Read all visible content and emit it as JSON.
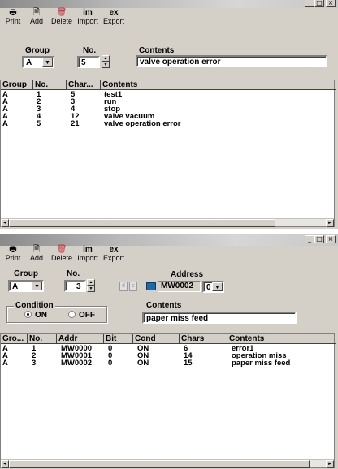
{
  "toolbar": {
    "print_label": "Print",
    "add_label": "Add",
    "delete_label": "Delete",
    "import_icon_text": "im",
    "import_label": "Import",
    "export_icon_text": "ex",
    "export_label": "Export"
  },
  "window_controls": {
    "minimize": "_",
    "maximize": "□",
    "close": "×"
  },
  "panel1": {
    "group_label": "Group",
    "group_value": "A",
    "no_label": "No.",
    "no_value": "5",
    "contents_label": "Contents",
    "contents_value": "valve operation error",
    "columns": [
      "Group",
      "No.",
      "Char...",
      "Contents"
    ],
    "rows": [
      {
        "group": "A",
        "no": "1",
        "chars": "5",
        "contents": "test1"
      },
      {
        "group": "A",
        "no": "2",
        "chars": "3",
        "contents": "run"
      },
      {
        "group": "A",
        "no": "3",
        "chars": "4",
        "contents": "stop"
      },
      {
        "group": "A",
        "no": "4",
        "chars": "12",
        "contents": "valve vacuum"
      },
      {
        "group": "A",
        "no": "5",
        "chars": "21",
        "contents": "valve operation error"
      }
    ]
  },
  "panel2": {
    "group_label": "Group",
    "group_value": "A",
    "no_label": "No.",
    "no_value": "3",
    "address_label": "Address",
    "address_d": "d",
    "address_c": "c",
    "address_value": "MW0002",
    "address_bit": "0",
    "condition_label": "Condition",
    "condition_on": "ON",
    "condition_off": "OFF",
    "contents_label": "Contents",
    "contents_value": "paper miss feed",
    "columns": [
      "Gro...",
      "No.",
      "Addr",
      "Bit",
      "Cond",
      "Chars",
      "Contents"
    ],
    "rows": [
      {
        "group": "A",
        "no": "1",
        "addr": "MW0000",
        "bit": "0",
        "cond": "ON",
        "chars": "6",
        "contents": "error1"
      },
      {
        "group": "A",
        "no": "2",
        "addr": "MW0001",
        "bit": "0",
        "cond": "ON",
        "chars": "14",
        "contents": "operation miss"
      },
      {
        "group": "A",
        "no": "3",
        "addr": "MW0002",
        "bit": "0",
        "cond": "ON",
        "chars": "15",
        "contents": "paper miss feed"
      }
    ]
  },
  "scroll": {
    "left": "◄",
    "right": "►"
  },
  "icons": {
    "print": "printer-icon",
    "add": "add-icon",
    "delete": "delete-icon",
    "dropdown": "▼",
    "spin_up": "▲",
    "spin_down": "▼"
  }
}
